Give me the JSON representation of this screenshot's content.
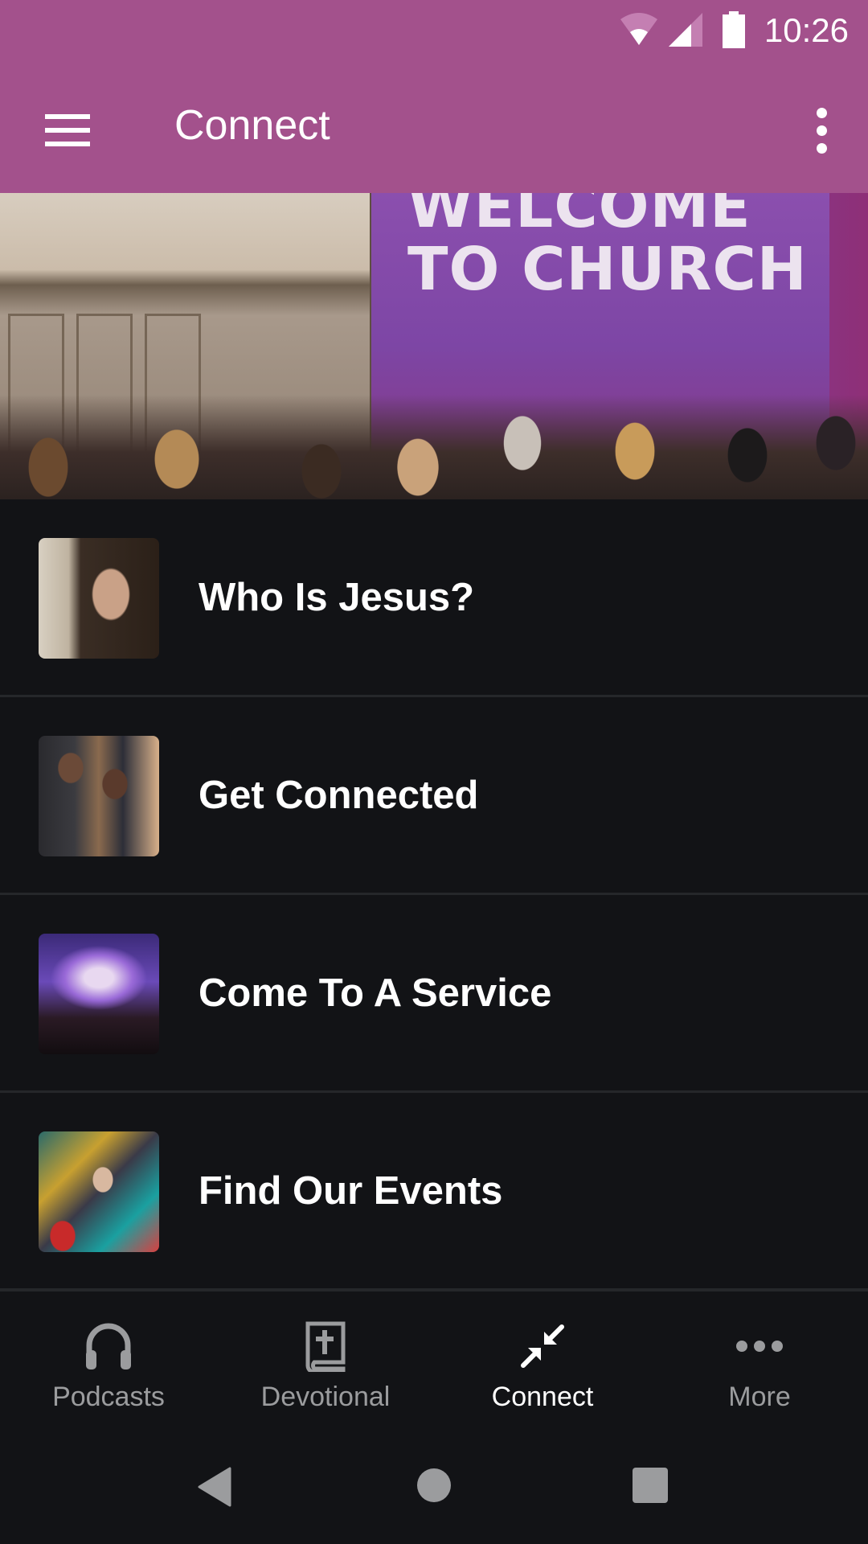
{
  "status_bar": {
    "time": "10:26",
    "icons": [
      "wifi-icon",
      "cell-signal-icon",
      "battery-icon"
    ]
  },
  "app_bar": {
    "title": "Connect",
    "menu_icon": "hamburger-menu-icon",
    "overflow_icon": "more-vert-icon",
    "background_color": "#a3518c"
  },
  "hero": {
    "banner_text": "WELCOME\nTO CHURCH",
    "image_description": "congregation facing a purple 'Welcome to Church' banner"
  },
  "list": {
    "items": [
      {
        "label": "Who Is Jesus?",
        "thumbnail": "portrait of Jesus"
      },
      {
        "label": "Get Connected",
        "thumbnail": "people laughing together"
      },
      {
        "label": "Come To A Service",
        "thumbnail": "worship concert crowd"
      },
      {
        "label": "Find Our Events",
        "thumbnail": "audience in seats"
      }
    ]
  },
  "bottom_nav": {
    "items": [
      {
        "label": "Podcasts",
        "icon": "headphones-icon",
        "active": false
      },
      {
        "label": "Devotional",
        "icon": "bible-icon",
        "active": false
      },
      {
        "label": "Connect",
        "icon": "connect-arrows-icon",
        "active": true
      },
      {
        "label": "More",
        "icon": "more-horiz-icon",
        "active": false
      }
    ],
    "active_color": "#ffffff",
    "inactive_color": "#9b9c9e"
  },
  "system_nav": {
    "buttons": [
      "back",
      "home",
      "recents"
    ]
  }
}
